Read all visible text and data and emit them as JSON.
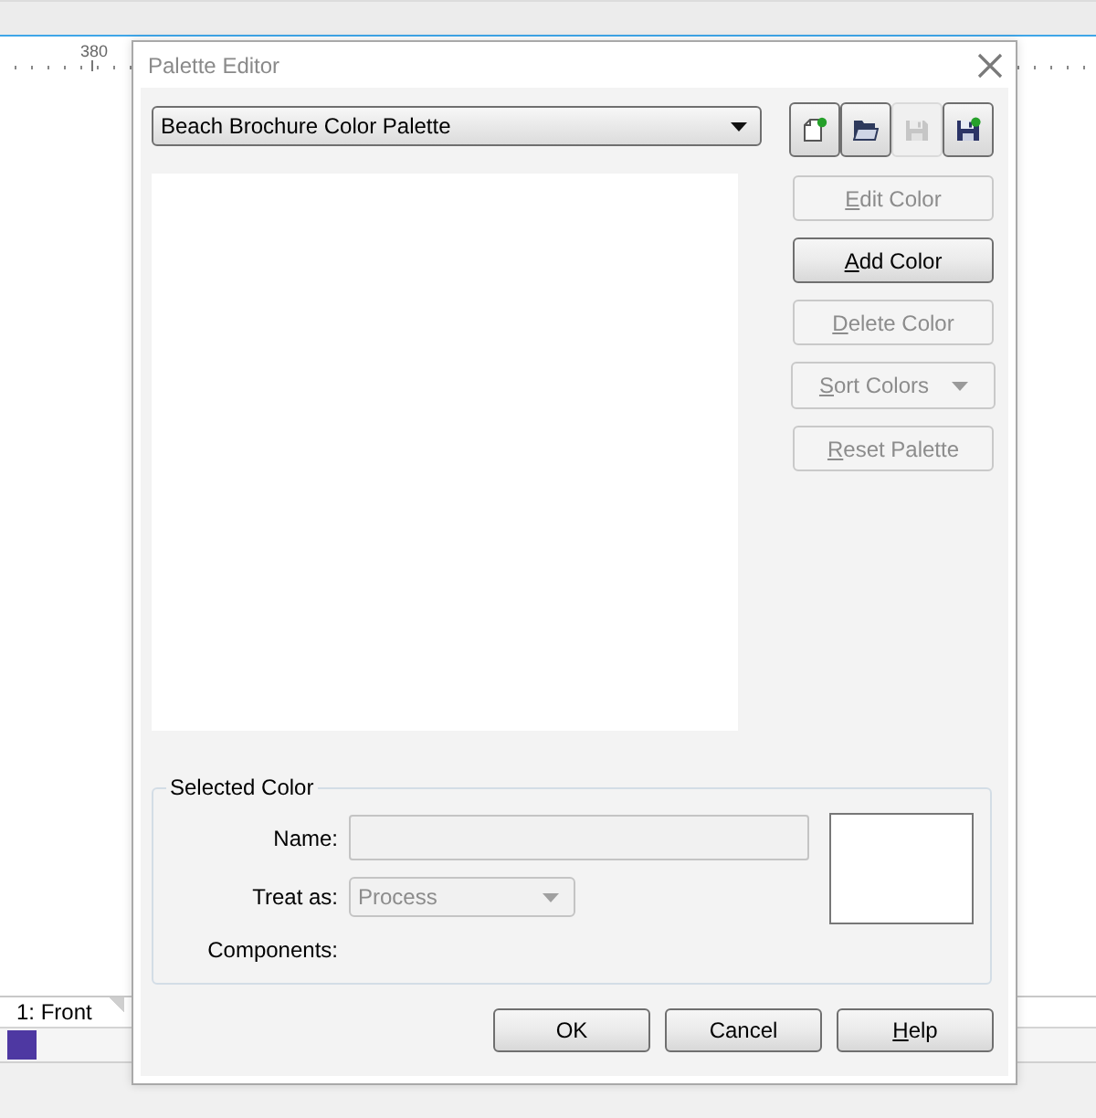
{
  "app": {
    "ruler": {
      "label": "380"
    },
    "page_tabs": [
      {
        "label": "1: Front",
        "selected": true
      }
    ],
    "document_swatches": [
      {
        "color": "#4e38a2"
      }
    ]
  },
  "dialog": {
    "title": "Palette Editor",
    "palette_select": {
      "value": "Beach Brochure Color Palette"
    },
    "toolbar": [
      {
        "kind": "new",
        "disabled": false
      },
      {
        "kind": "open",
        "disabled": false
      },
      {
        "kind": "save",
        "disabled": true
      },
      {
        "kind": "save_as",
        "disabled": false
      }
    ],
    "actions": [
      {
        "label": "Edit Color",
        "first_letter_underlined": true,
        "kind": "button",
        "disabled": true
      },
      {
        "label": "Add Color",
        "first_letter_underlined": true,
        "kind": "button",
        "disabled": false
      },
      {
        "label": "Delete Color",
        "first_letter_underlined": true,
        "kind": "button",
        "disabled": true
      },
      {
        "label": "Sort Colors",
        "first_letter_underlined": true,
        "kind": "menu",
        "disabled": true
      },
      {
        "label": "Reset Palette",
        "first_letter_underlined": true,
        "kind": "button",
        "disabled": true
      }
    ],
    "selected_color": {
      "legend": "Selected Color",
      "name": {
        "label": "Name:",
        "disabled": true
      },
      "treat_as": {
        "label": "Treat as:",
        "value": "Process",
        "disabled": true
      },
      "components": {
        "label": "Components:"
      }
    },
    "buttons": [
      {
        "label": "OK",
        "first_letter_underlined": false,
        "disabled": false
      },
      {
        "label": "Cancel",
        "first_letter_underlined": false,
        "disabled": false
      },
      {
        "label": "Help",
        "first_letter_underlined": true,
        "disabled": false
      }
    ]
  }
}
